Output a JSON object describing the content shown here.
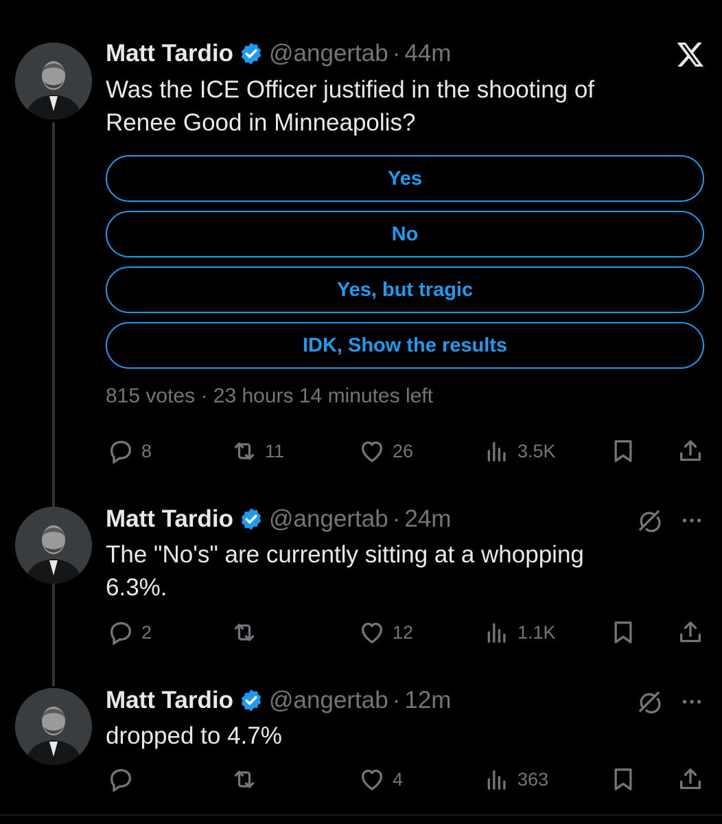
{
  "tweets": [
    {
      "name": "Matt Tardio",
      "handle": "@angertab",
      "separator": "·",
      "time": "44m",
      "text_line1": "Was the ICE Officer justified in the shooting of",
      "text_line2": "Renee Good in Minneapolis?",
      "poll": {
        "options": [
          "Yes",
          "No",
          "Yes, but tragic",
          "IDK, Show the results"
        ],
        "votes": "815 votes",
        "separator": "·",
        "time_left": "23 hours 14 minutes left"
      },
      "stats": {
        "replies": "8",
        "reposts": "11",
        "likes": "26",
        "views": "3.5K"
      }
    },
    {
      "name": "Matt Tardio",
      "handle": "@angertab",
      "separator": "·",
      "time": "24m",
      "text_line1": "The \"No's\" are currently sitting at a whopping",
      "text_line2": "6.3%.",
      "stats": {
        "replies": "2",
        "reposts": "",
        "likes": "12",
        "views": "1.1K"
      }
    },
    {
      "name": "Matt Tardio",
      "handle": "@angertab",
      "separator": "·",
      "time": "12m",
      "text_line1": "dropped to 4.7%",
      "stats": {
        "replies": "",
        "reposts": "",
        "likes": "4",
        "views": "363"
      }
    }
  ],
  "icons": {
    "brand": "x-logo-icon",
    "verified": "verified-badge-icon",
    "reply": "reply-icon",
    "repost": "repost-icon",
    "like": "heart-icon",
    "views": "views-chart-icon",
    "bookmark": "bookmark-icon",
    "share": "share-icon",
    "mute": "mute-icon",
    "more": "more-icon"
  },
  "colors": {
    "background": "#000000",
    "text": "#e7e9ea",
    "muted": "#71767b",
    "accent": "#1d9bf0",
    "thread_line": "#333639"
  }
}
